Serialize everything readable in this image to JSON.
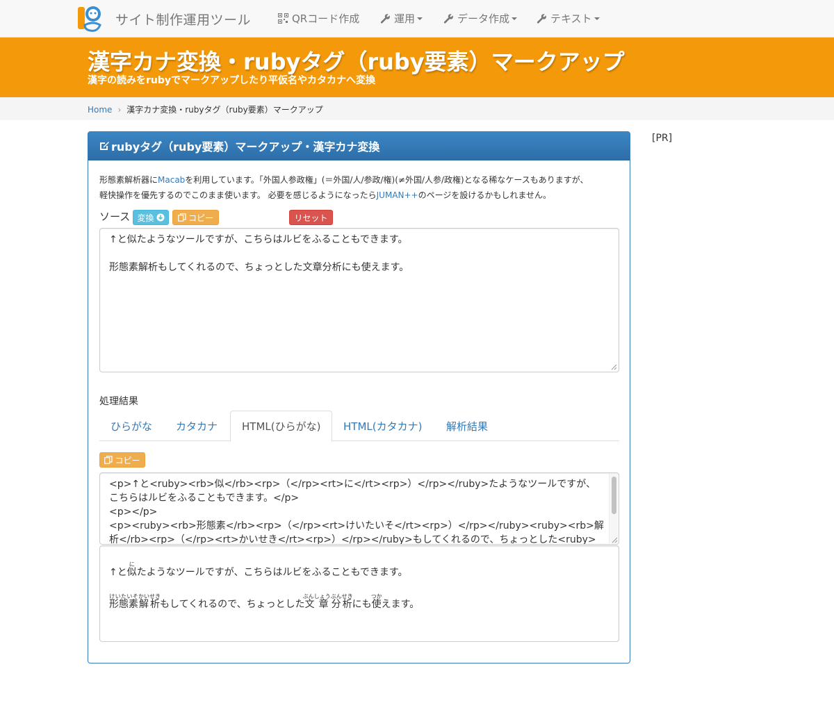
{
  "nav": {
    "brand": "サイト制作運用ツール",
    "qr": "QRコード作成",
    "ops": "運用",
    "data_gen": "データ作成",
    "text": "テキスト"
  },
  "hero": {
    "title": "漢字カナ変換・rubyタグ（ruby要素）マークアップ",
    "subtitle": "漢字の読みをrubyでマークアップしたり平仮名やカタカナへ変換"
  },
  "breadcrumb": {
    "home": "Home",
    "current": "漢字カナ変換・rubyタグ（ruby要素）マークアップ"
  },
  "pr": "[PR]",
  "panel": {
    "title": "rubyタグ（ruby要素）マークアップ・漢字カナ変換",
    "intro": {
      "p1": "形態素解析器に",
      "macab": "Macab",
      "p2": "を利用しています。「外国人参政権」(＝外国/人/参政/権)(≠外国/人参/政権)となる稀なケースもありますが、",
      "p3": "軽快操作を優先するのでこのまま使います。 必要を感じるようになったら",
      "juman": "JUMAN++",
      "p4": "のページを設けるかもしれません。"
    },
    "source_label": "ソース",
    "convert_btn": "変換",
    "copy_btn": "コピー",
    "reset_btn": "リセット",
    "source_text": "↑と似たようなツールですが、こちらはルビをふることもできます。\n\n形態素解析もしてくれるので、ちょっとした文章分析にも使えます。",
    "result_label": "処理結果",
    "tabs": [
      "ひらがな",
      "カタカナ",
      "HTML(ひらがな)",
      "HTML(カタカナ)",
      "解析結果"
    ],
    "active_tab": "HTML(ひらがな)",
    "copy_btn2": "コピー",
    "html_output": "<p>↑と<ruby><rb>似</rb><rp>（</rp><rt>に</rt><rp>）</rp></ruby>たようなツールですが、こちらはルビをふることもできます。</p>\n<p></p>\n<p><ruby><rb>形態素</rb><rp>（</rp><rt>けいたいそ</rt><rp>）</rp></ruby><ruby><rb>解析</rb><rp>（</rp><rt>かいせき</rt><rp>）</rp></ruby>もしてくれるので、ちょっとした<ruby><rb>文章</rb>",
    "preview": {
      "l1_a": "↑と",
      "l1_rb": "似",
      "l1_rt": "に",
      "l1_b": "たようなツールですが、こちらはルビをふることもできます。",
      "l2_rb1": "形態素",
      "l2_rt1": "けいたいそ",
      "l2_rb2": "解析",
      "l2_rt2": "かいせき",
      "l2_a": "もしてくれるので、ちょっとした",
      "l2_rb3": "文章",
      "l2_rt3": "ぶんしょう",
      "l2_rb4": "分析",
      "l2_rt4": "ぶんせき",
      "l2_b": "にも",
      "l2_rb5": "使",
      "l2_rt5": "つか",
      "l2_c": "えます。"
    }
  },
  "colors": {
    "hero": "#f49a0a",
    "panel_heading": "#337ab7",
    "link": "#337ab7",
    "info_btn": "#5bc0de",
    "warn_btn": "#f0ad4e",
    "danger_btn": "#d9534f"
  }
}
